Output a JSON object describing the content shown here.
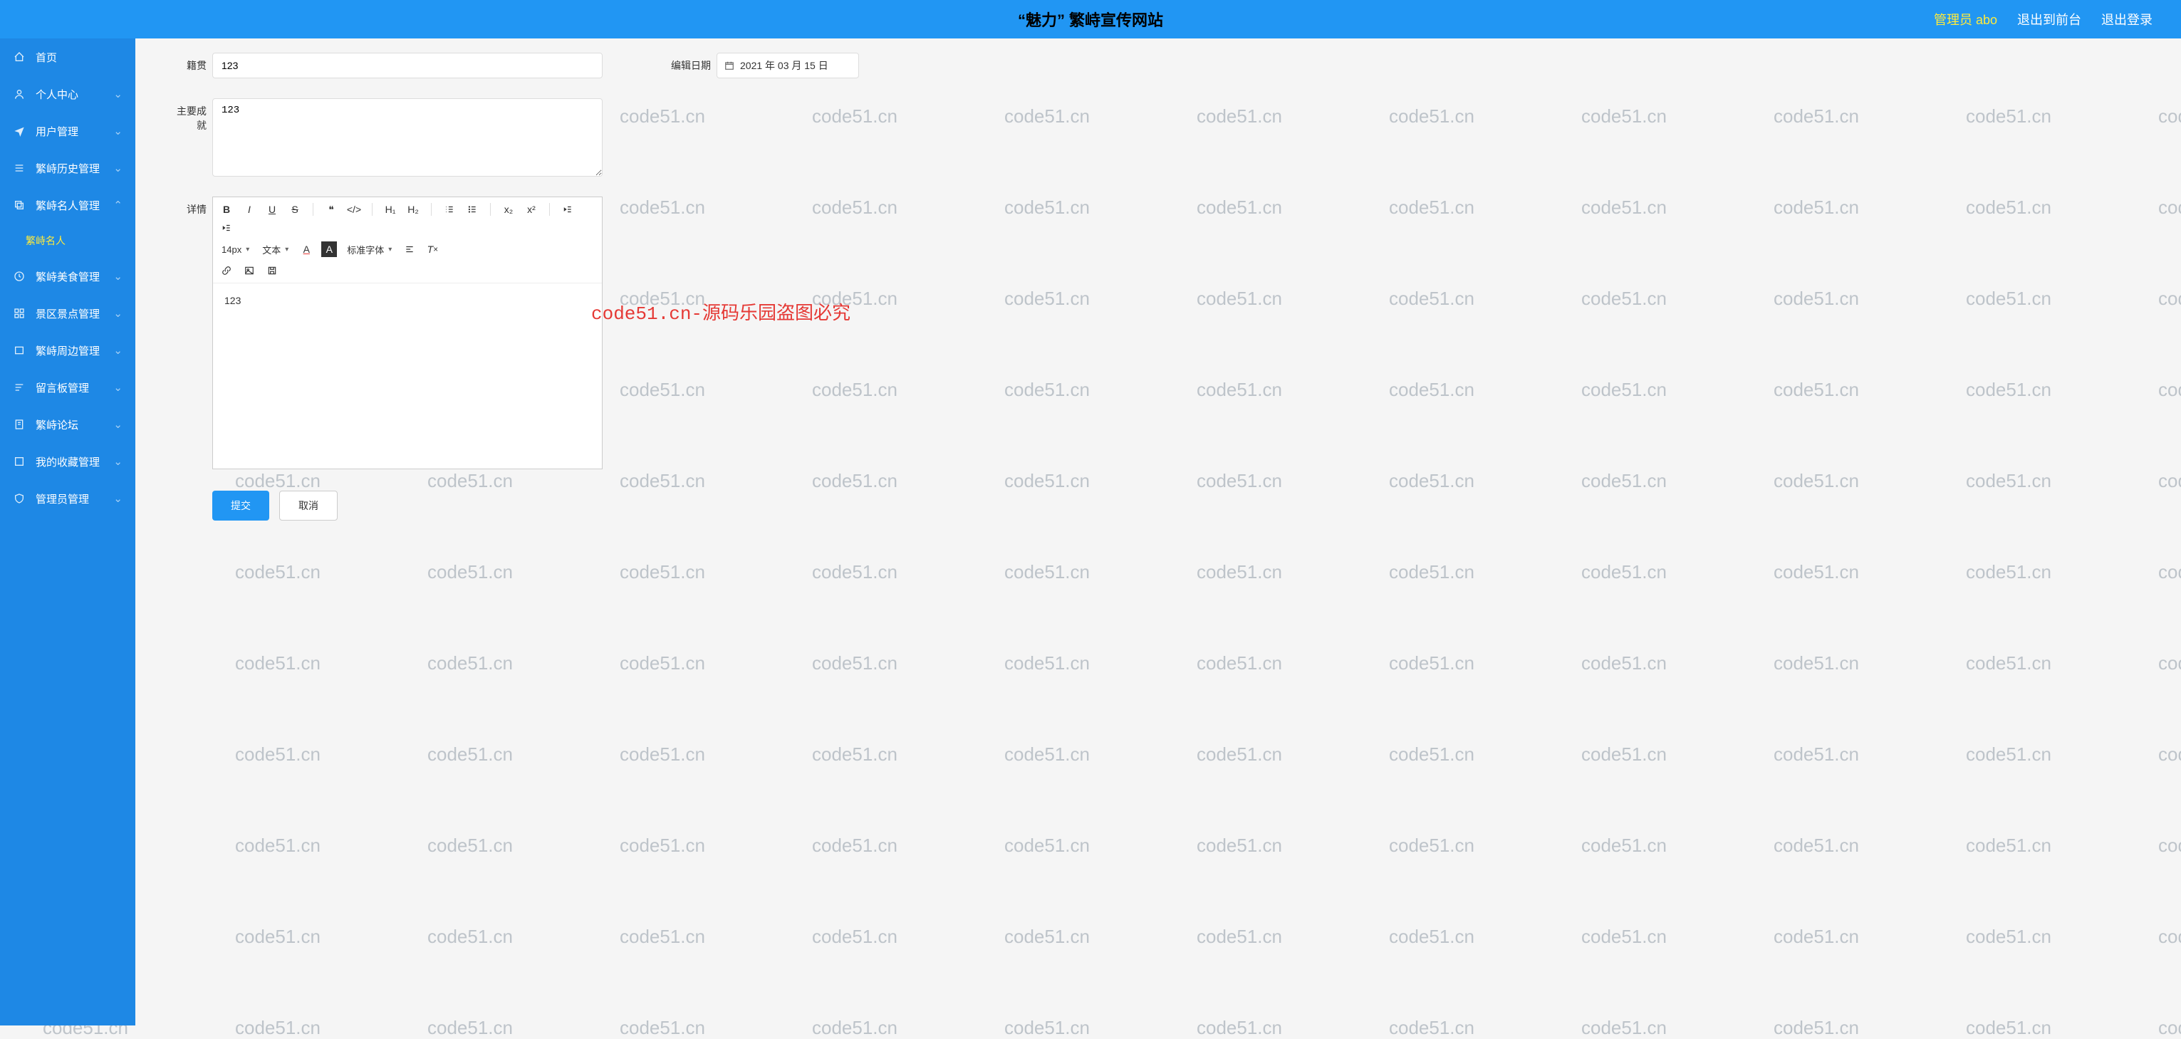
{
  "header": {
    "title": "“魅力” 繁峙宣传网站",
    "admin_label": "管理员 abo",
    "link_front": "退出到前台",
    "link_logout": "退出登录"
  },
  "sidebar": {
    "items": [
      {
        "key": "home",
        "label": "首页",
        "icon": "home-icon",
        "expandable": false
      },
      {
        "key": "personal",
        "label": "个人中心",
        "icon": "user-icon",
        "expandable": true
      },
      {
        "key": "users",
        "label": "用户管理",
        "icon": "plane-icon",
        "expandable": true
      },
      {
        "key": "history",
        "label": "繁峙历史管理",
        "icon": "list-icon",
        "expandable": true
      },
      {
        "key": "famous",
        "label": "繁峙名人管理",
        "icon": "copy-icon",
        "expandable": true,
        "open": true
      },
      {
        "key": "food",
        "label": "繁峙美食管理",
        "icon": "clock-icon",
        "expandable": true
      },
      {
        "key": "scenic",
        "label": "景区景点管理",
        "icon": "grid-icon",
        "expandable": true
      },
      {
        "key": "surround",
        "label": "繁峙周边管理",
        "icon": "layers-icon",
        "expandable": true
      },
      {
        "key": "guestbook",
        "label": "留言板管理",
        "icon": "bars-icon",
        "expandable": true
      },
      {
        "key": "forum",
        "label": "繁峙论坛",
        "icon": "doc-icon",
        "expandable": true
      },
      {
        "key": "favorites",
        "label": "我的收藏管理",
        "icon": "square-icon",
        "expandable": true
      },
      {
        "key": "admins",
        "label": "管理员管理",
        "icon": "shield-icon",
        "expandable": true
      }
    ],
    "submenu_famous": "繁峙名人"
  },
  "form": {
    "jiguan_label": "籍贯",
    "jiguan_value": "123",
    "date_label": "编辑日期",
    "date_value": "2021 年 03 月 15 日",
    "chengjiu_label": "主要成就",
    "chengjiu_value": "123",
    "detail_label": "详情",
    "editor_content": "123"
  },
  "editor_toolbar": {
    "font_size": "14px",
    "style_label": "文本",
    "font_family": "标准字体"
  },
  "actions": {
    "submit": "提交",
    "cancel": "取消"
  },
  "watermark": {
    "text": "code51.cn",
    "center_text": "code51.cn-源码乐园盗图必究"
  }
}
